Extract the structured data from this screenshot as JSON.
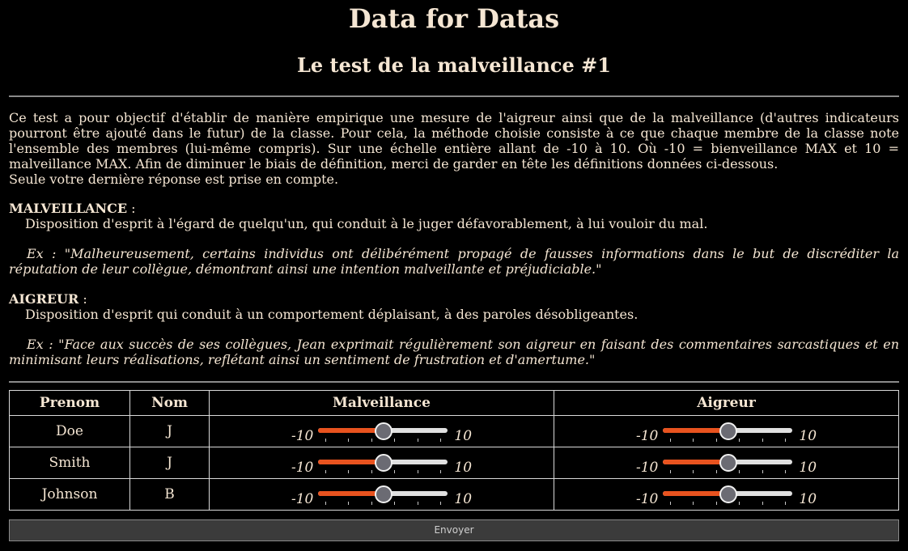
{
  "header": {
    "title": "Data for Datas",
    "subtitle": "Le test de la malveillance #1"
  },
  "intro": {
    "paragraph": "Ce test a pour objectif d'établir de manière empirique une mesure de l'aigreur ainsi que de la malveillance (d'autres indicateurs pourront être ajouté dans le futur) de la classe. Pour cela, la méthode choisie consiste à ce que chaque membre de la classe note l'ensemble des membres (lui-même compris). Sur une échelle entière allant de -10 à 10. Où -10 = bienveillance MAX et 10 = malveillance MAX. Afin de diminuer le biais de définition, merci de garder en tête les définitions données ci-dessous.",
    "note": "Seule votre dernière réponse est prise en compte."
  },
  "definitions": [
    {
      "term": "MALVEILLANCE",
      "suffix": " :",
      "meaning": "Disposition d'esprit à l'égard de quelqu'un, qui conduit à le juger défavorablement, à lui vouloir du mal.",
      "example": "Ex : \"Malheureusement, certains individus ont délibérément propagé de fausses informations dans le but de discréditer la réputation de leur collègue, démontrant ainsi une intention malveillante et préjudiciable.\""
    },
    {
      "term": "AIGREUR",
      "suffix": " :",
      "meaning": "Disposition d'esprit qui conduit à un comportement déplaisant, à des paroles désobligeantes.",
      "example": "Ex : \"Face aux succès de ses collègues, Jean exprimait régulièrement son aigreur en faisant des commentaires sarcastiques et en minimisant leurs réalisations, reflétant ainsi un sentiment de frustration et d'amertume.\""
    }
  ],
  "table": {
    "headers": [
      "Prenom",
      "Nom",
      "Malveillance",
      "Aigreur"
    ],
    "slider_min_label": "-10",
    "slider_max_label": "10",
    "slider_min": -10,
    "slider_max": 10,
    "rows": [
      {
        "prenom": "Doe",
        "nom": "J",
        "malveillance": 0,
        "aigreur": 0
      },
      {
        "prenom": "Smith",
        "nom": "J",
        "malveillance": 0,
        "aigreur": 0
      },
      {
        "prenom": "Johnson",
        "nom": "B",
        "malveillance": 0,
        "aigreur": 0
      }
    ]
  },
  "submit": {
    "label": "Envoyer"
  },
  "colors": {
    "background": "#000000",
    "text": "#f5e6d3",
    "slider_fill": "#e8531f",
    "slider_track": "#e0e0e0",
    "slider_thumb": "#6b6b73",
    "button_bg": "#3b3b3b"
  }
}
